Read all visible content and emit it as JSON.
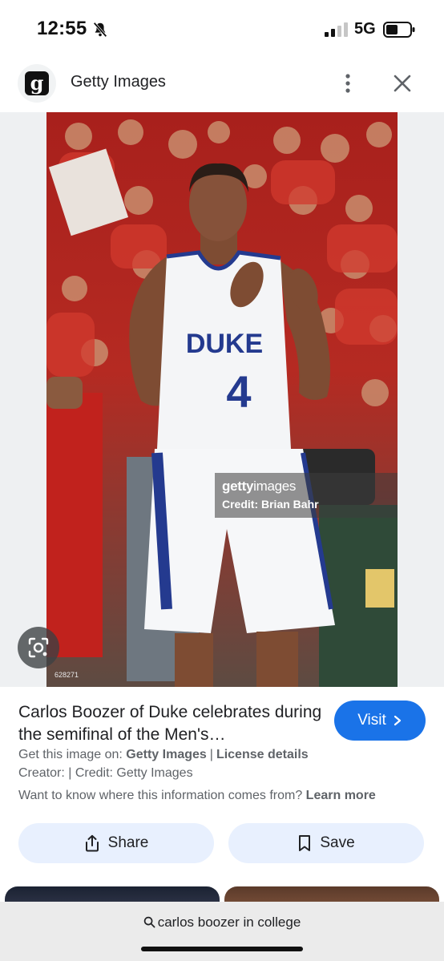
{
  "status_bar": {
    "time": "12:55",
    "network": "5G",
    "icons": [
      "bell-off-icon",
      "signal-icon",
      "battery-icon"
    ]
  },
  "header": {
    "site_name": "Getty Images",
    "logo_letter": "g",
    "icons": [
      "more-vert-icon",
      "close-icon"
    ]
  },
  "image": {
    "watermark_brand": "getty",
    "watermark_brand_suffix": "images",
    "watermark_credit": "Credit: Brian Bahr",
    "image_id": "628271",
    "jersey_text": "DUKE",
    "jersey_number": "4",
    "lens_icon": "lens-search-icon"
  },
  "details": {
    "title": "Carlos Boozer of Duke celebrates during the semifinal of the Men's…",
    "visit_label": "Visit",
    "get_image_prefix": "Get this image on:",
    "get_image_source": "Getty Images",
    "separator": "|",
    "license_label": "License details",
    "creator_line": "Creator: | Credit: Getty Images",
    "info_question": "Want to know where this information comes from?",
    "learn_more": "Learn more",
    "share_label": "Share",
    "save_label": "Save"
  },
  "bottom": {
    "search_query": "carlos boozer in college"
  },
  "colors": {
    "accent_blue": "#1a73e8",
    "chip_blue": "#e8f0fe",
    "text_primary": "#202124",
    "text_secondary": "#5f6368"
  }
}
